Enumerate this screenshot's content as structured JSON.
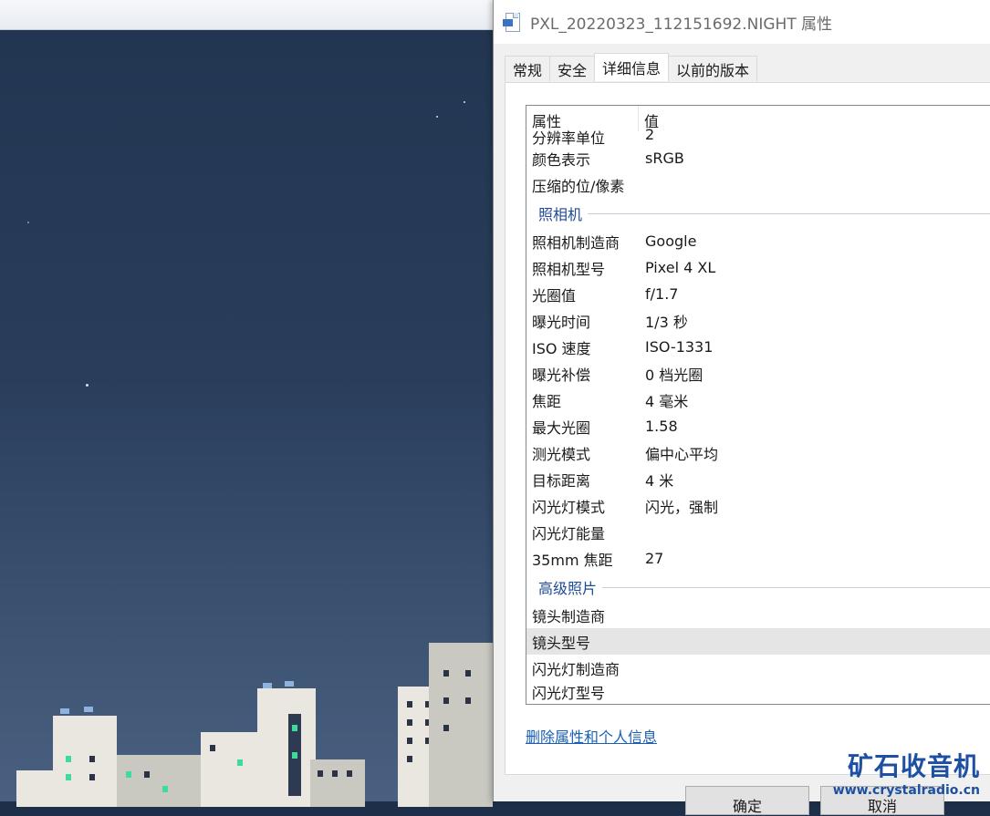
{
  "dialog": {
    "title": "PXL_20220323_112151692.NIGHT 属性",
    "tabs": [
      {
        "label": "常规"
      },
      {
        "label": "安全"
      },
      {
        "label": "详细信息"
      },
      {
        "label": "以前的版本"
      }
    ],
    "active_tab": "详细信息",
    "list_header": {
      "property": "属性",
      "value": "值"
    },
    "rows_top": [
      {
        "k": "分辨率单位",
        "v": "2"
      },
      {
        "k": "颜色表示",
        "v": "sRGB"
      },
      {
        "k": "压缩的位/像素",
        "v": ""
      }
    ],
    "group_camera": "照相机",
    "rows_camera": [
      {
        "k": "照相机制造商",
        "v": "Google"
      },
      {
        "k": "照相机型号",
        "v": "Pixel 4 XL"
      },
      {
        "k": "光圈值",
        "v": "f/1.7"
      },
      {
        "k": "曝光时间",
        "v": "1/3 秒"
      },
      {
        "k": "ISO 速度",
        "v": "ISO-1331"
      },
      {
        "k": "曝光补偿",
        "v": "0 档光圈"
      },
      {
        "k": "焦距",
        "v": "4 毫米"
      },
      {
        "k": "最大光圈",
        "v": "1.58"
      },
      {
        "k": "测光模式",
        "v": "偏中心平均"
      },
      {
        "k": "目标距离",
        "v": "4 米"
      },
      {
        "k": "闪光灯模式",
        "v": "闪光，强制"
      },
      {
        "k": "闪光灯能量",
        "v": ""
      },
      {
        "k": "35mm 焦距",
        "v": "27"
      }
    ],
    "group_advanced": "高级照片",
    "rows_advanced": [
      {
        "k": "镜头制造商",
        "v": ""
      },
      {
        "k": "镜头型号",
        "v": "",
        "selected": true
      },
      {
        "k": "闪光灯制造商",
        "v": ""
      },
      {
        "k": "闪光灯型号",
        "v": ""
      }
    ],
    "remove_link": "删除属性和个人信息",
    "ok_button": "确定",
    "cancel_button": "取消"
  },
  "watermark": {
    "logo": "矿石收音机",
    "url": "www.crystalradio.cn"
  }
}
